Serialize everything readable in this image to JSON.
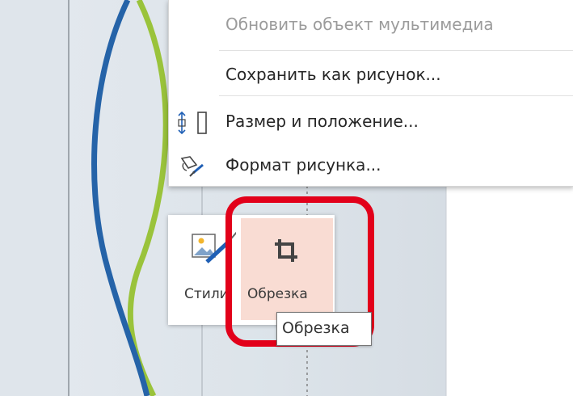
{
  "context_menu": {
    "items": [
      {
        "label": "Обновить объект мультимедиа",
        "disabled": true,
        "icon": ""
      },
      {
        "label": "Сохранить как рисунок...",
        "disabled": false,
        "icon": ""
      },
      {
        "label": "Размер и положение...",
        "disabled": false,
        "icon": "size-position-icon"
      },
      {
        "label": "Формат рисунка...",
        "disabled": false,
        "icon": "format-picture-icon"
      }
    ]
  },
  "mini_toolbar": {
    "style_label": "Стили",
    "style_icon": "picture-styles-icon",
    "crop_label": "Обрезка",
    "crop_icon": "crop-icon"
  },
  "tooltip": {
    "text": "Обрезка"
  },
  "colors": {
    "highlight": "#e2001a",
    "crop_hover": "#f9dcd3",
    "curve_blue": "#2563a8",
    "curve_green": "#9ac33b"
  }
}
